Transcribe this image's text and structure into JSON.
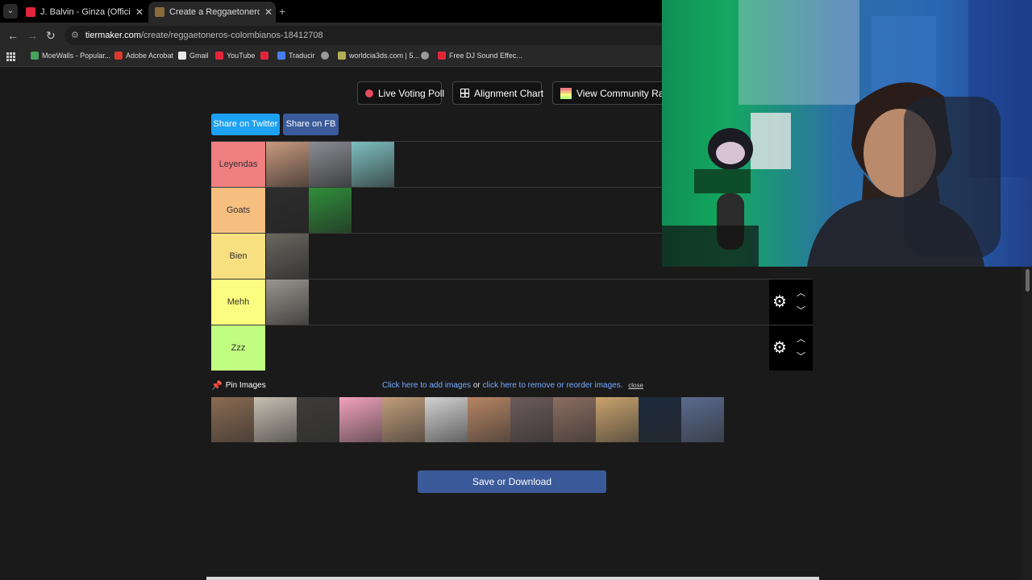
{
  "browser": {
    "tabs": [
      {
        "title": "J. Balvin - Ginza (Official Video)",
        "favicon_color": "#e3253b",
        "active": false
      },
      {
        "title": "Create a Reggaetoneros colombianos",
        "favicon_color": "#8c6b3a",
        "active": true
      }
    ],
    "url_host": "tiermaker.com",
    "url_path": "/create/reggaetoneros-colombianos-18412708",
    "bookmarks": [
      {
        "label": "MoeWalls - Popular...",
        "color": "#4aa35a"
      },
      {
        "label": "Adobe Acrobat",
        "color": "#d93a2b"
      },
      {
        "label": "Gmail",
        "color": "#e9e9e9"
      },
      {
        "label": "YouTube",
        "color": "#e3253b"
      },
      {
        "label": "",
        "color": "#e3253b"
      },
      {
        "label": "Traducir",
        "color": "#4b7ef0"
      },
      {
        "label": "",
        "color": "#9a9a9a"
      },
      {
        "label": "worldcia3ds.com | 5...",
        "color": "#b0b054"
      },
      {
        "label": "",
        "color": "#9a9a9a"
      },
      {
        "label": "Free DJ Sound Effec...",
        "color": "#e3253b"
      }
    ]
  },
  "toolbar_buttons": {
    "live_poll": "Live Voting Poll",
    "alignment": "Alignment Chart",
    "community": "View Community Rank"
  },
  "share": {
    "twitter": "Share on Twitter",
    "fb": "Share on FB"
  },
  "tiers": [
    {
      "label": "Leyendas",
      "color": "#f07f80",
      "items": [
        "#c99a7e",
        "#8a8d93",
        "#7fbfc0"
      ],
      "controls_visible": false
    },
    {
      "label": "Goats",
      "color": "#f6bf80",
      "items": [
        "#2e2e2e",
        "#2f8f3a"
      ],
      "controls_visible": false
    },
    {
      "label": "Bien",
      "color": "#f8df80",
      "items": [
        "#6a6660"
      ],
      "controls_visible": false
    },
    {
      "label": "Mehh",
      "color": "#fbfd80",
      "items": [
        "#9a968f"
      ],
      "controls_visible": true
    },
    {
      "label": "Zzz",
      "color": "#c0fd80",
      "items": [],
      "controls_visible": true
    }
  ],
  "pin_images": "Pin Images",
  "add_images": {
    "link1": "Click here to add images",
    "or": "or",
    "link2": "click here to remove or reorder images.",
    "close": "close"
  },
  "pool_images": [
    "#8b6b52",
    "#c7bfb3",
    "#3d3c3a",
    "#f2a2be",
    "#c09d7a",
    "#d2d2d2",
    "#b68563",
    "#6b5a5b",
    "#8b6d60",
    "#c9a36d",
    "#1c2a3d",
    "#5a6b8f"
  ],
  "save_button": "Save or Download"
}
